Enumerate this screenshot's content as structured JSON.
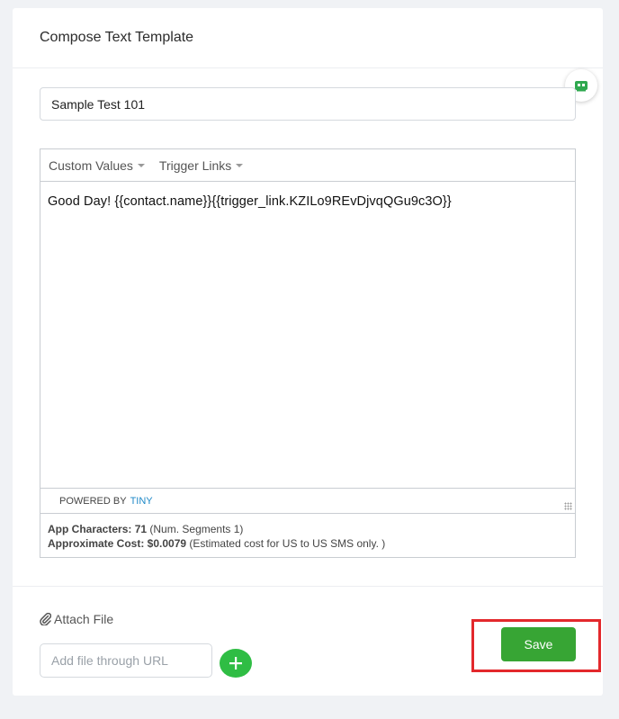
{
  "header": {
    "title": "Compose Text Template"
  },
  "template_name": {
    "value": "Sample Test 101"
  },
  "editor": {
    "menus": [
      {
        "label": "Custom Values"
      },
      {
        "label": "Trigger Links"
      }
    ],
    "content": "Good Day! {{contact.name}}{{trigger_link.KZILo9REvDjvqQGu9c3O}}",
    "powered_by": "POWERED BY",
    "powered_brand": "TINY"
  },
  "counts": {
    "app_chars_label": "App Characters: 71",
    "app_chars_note": "(Num. Segments 1)",
    "cost_label": "Approximate Cost: $0.0079",
    "cost_note": "(Estimated cost for US to US SMS only. )"
  },
  "attach": {
    "label": "Attach File",
    "url_placeholder": "Add file through URL",
    "url_value": ""
  },
  "actions": {
    "save_label": "Save"
  },
  "colors": {
    "save": "#37a534",
    "add": "#2fbd44",
    "highlight": "#e3282c",
    "brand_link": "#1e88c7",
    "robot_icon": "#2fa84f"
  }
}
